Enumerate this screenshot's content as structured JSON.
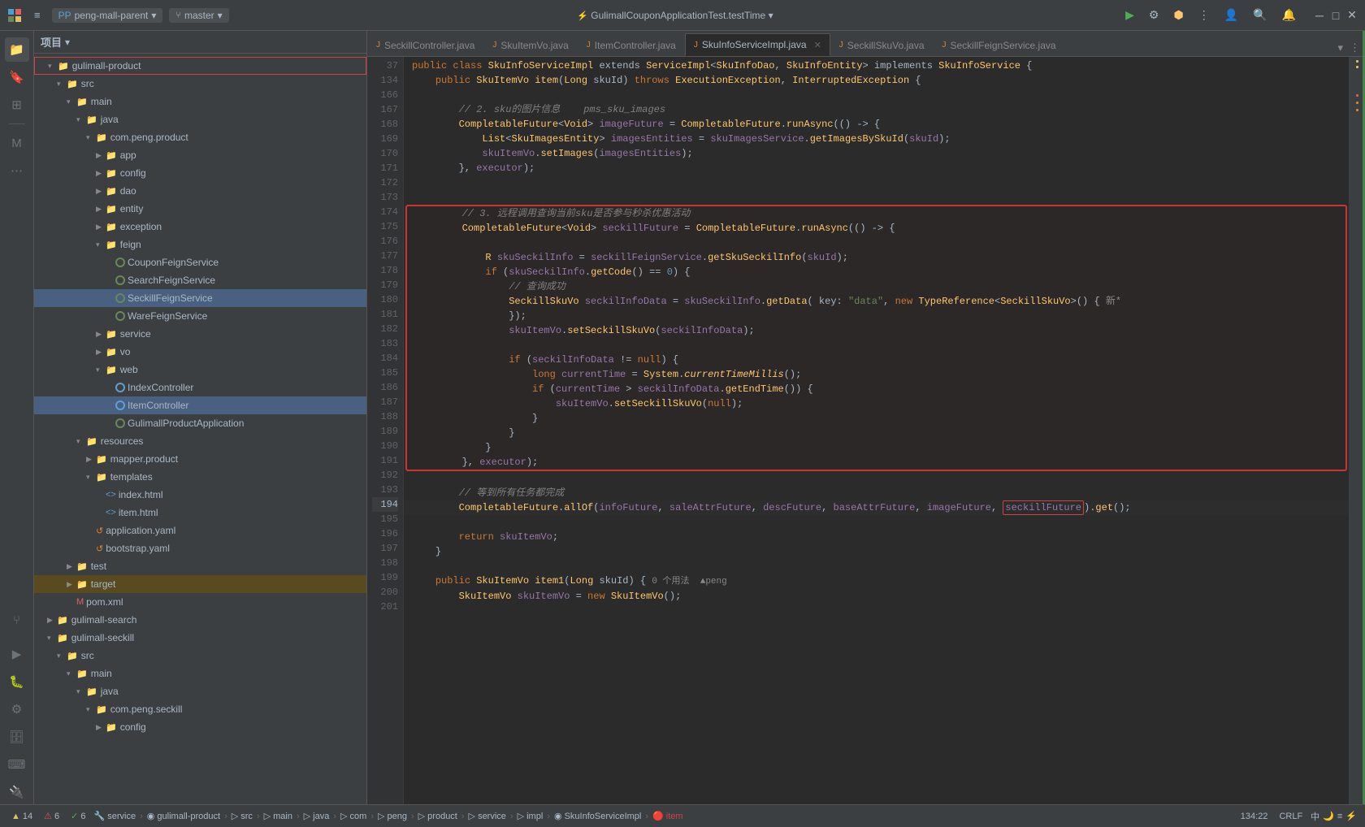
{
  "titlebar": {
    "logo": "◆",
    "menu_icon": "≡",
    "project_label": "peng-mall-parent",
    "branch_label": "master",
    "center_title": "GulimallCouponApplicationTest.testTime",
    "run_btn": "▶",
    "build_btn": "⚙",
    "vcs_btn": "⎇",
    "more_btn": "⋮",
    "user_btn": "👤",
    "search_btn": "🔍",
    "notifications_btn": "🔔",
    "minimize_btn": "─",
    "maximize_btn": "□",
    "close_btn": "✕"
  },
  "tabs": [
    {
      "label": "SeckillController.java",
      "active": false,
      "icon": "J"
    },
    {
      "label": "SkuItemVo.java",
      "active": false,
      "icon": "J"
    },
    {
      "label": "ItemController.java",
      "active": false,
      "icon": "J"
    },
    {
      "label": "SkuInfoServiceImpl.java",
      "active": true,
      "icon": "J"
    },
    {
      "label": "SeckillSkuVo.java",
      "active": false,
      "icon": "J"
    },
    {
      "label": "SeckillFeignService.java",
      "active": false,
      "icon": "J"
    }
  ],
  "project_header": {
    "title": "项目",
    "chevron": "▾"
  },
  "tree": [
    {
      "label": "gulimall-product",
      "indent": 1,
      "type": "folder_open",
      "highlighted": true,
      "arrow": "▾"
    },
    {
      "label": "src",
      "indent": 2,
      "type": "folder_open",
      "arrow": "▾"
    },
    {
      "label": "main",
      "indent": 3,
      "type": "folder_open",
      "arrow": "▾"
    },
    {
      "label": "java",
      "indent": 4,
      "type": "folder_open",
      "arrow": "▾"
    },
    {
      "label": "com.peng.product",
      "indent": 5,
      "type": "folder_open",
      "arrow": "▾"
    },
    {
      "label": "app",
      "indent": 6,
      "type": "folder",
      "arrow": "▶"
    },
    {
      "label": "config",
      "indent": 6,
      "type": "folder",
      "arrow": "▶"
    },
    {
      "label": "dao",
      "indent": 6,
      "type": "folder",
      "arrow": "▶"
    },
    {
      "label": "entity",
      "indent": 6,
      "type": "folder",
      "arrow": "▶"
    },
    {
      "label": "exception",
      "indent": 6,
      "type": "folder",
      "arrow": "▶"
    },
    {
      "label": "feign",
      "indent": 6,
      "type": "folder_open",
      "arrow": "▾"
    },
    {
      "label": "CouponFeignService",
      "indent": 7,
      "type": "circle_green"
    },
    {
      "label": "SearchFeignService",
      "indent": 7,
      "type": "circle_green"
    },
    {
      "label": "SeckillFeignService",
      "indent": 7,
      "type": "circle_green",
      "selected": true
    },
    {
      "label": "WareFeignService",
      "indent": 7,
      "type": "circle_green"
    },
    {
      "label": "service",
      "indent": 6,
      "type": "folder",
      "arrow": "▶"
    },
    {
      "label": "vo",
      "indent": 6,
      "type": "folder",
      "arrow": "▶"
    },
    {
      "label": "web",
      "indent": 6,
      "type": "folder_open",
      "arrow": "▾"
    },
    {
      "label": "IndexController",
      "indent": 7,
      "type": "circle_blue"
    },
    {
      "label": "ItemController",
      "indent": 7,
      "type": "circle_blue",
      "selected_file": true
    },
    {
      "label": "GulimallProductApplication",
      "indent": 7,
      "type": "circle_green"
    },
    {
      "label": "resources",
      "indent": 4,
      "type": "folder_open",
      "arrow": "▾"
    },
    {
      "label": "mapper.product",
      "indent": 5,
      "type": "folder",
      "arrow": "▶"
    },
    {
      "label": "templates",
      "indent": 5,
      "type": "folder_open",
      "arrow": "▾"
    },
    {
      "label": "index.html",
      "indent": 6,
      "type": "html_file"
    },
    {
      "label": "item.html",
      "indent": 6,
      "type": "html_file"
    },
    {
      "label": "application.yaml",
      "indent": 5,
      "type": "yaml_file"
    },
    {
      "label": "bootstrap.yaml",
      "indent": 5,
      "type": "yaml_file"
    },
    {
      "label": "test",
      "indent": 3,
      "type": "folder",
      "arrow": "▶"
    },
    {
      "label": "target",
      "indent": 3,
      "type": "folder_target",
      "arrow": "▶"
    },
    {
      "label": "pom.xml",
      "indent": 3,
      "type": "xml_file"
    },
    {
      "label": "gulimall-search",
      "indent": 1,
      "type": "folder",
      "arrow": "▶"
    },
    {
      "label": "gulimall-seckill",
      "indent": 1,
      "type": "folder_open",
      "arrow": "▾"
    },
    {
      "label": "src",
      "indent": 2,
      "type": "folder_open",
      "arrow": "▾"
    },
    {
      "label": "main",
      "indent": 3,
      "type": "folder_open",
      "arrow": "▾"
    },
    {
      "label": "java",
      "indent": 4,
      "type": "folder_open",
      "arrow": "▾"
    },
    {
      "label": "com.peng.seckill",
      "indent": 5,
      "type": "folder_open",
      "arrow": "▾"
    },
    {
      "label": "config",
      "indent": 6,
      "type": "folder",
      "arrow": "▶"
    }
  ],
  "code_lines": [
    {
      "num": 37,
      "content": "public class SkuInfoServiceImpl extends ServiceImpl<SkuInfoDao, SkuInfoEntity> implements SkuInfoService {",
      "type": "normal"
    },
    {
      "num": 134,
      "content": "    public SkuItemVo item(Long skuId) throws ExecutionException, InterruptedException {",
      "type": "normal"
    },
    {
      "num": 166,
      "content": "",
      "type": "normal"
    },
    {
      "num": 167,
      "content": "        // 2. sku的图片信息    pms_sku_images",
      "type": "comment"
    },
    {
      "num": 168,
      "content": "        CompletableFuture<Void> imageFuture = CompletableFuture.runAsync(() -> {",
      "type": "normal"
    },
    {
      "num": 169,
      "content": "            List<SkuImagesEntity> imagesEntities = skuImagesService.getImagesBySkuId(skuId);",
      "type": "normal"
    },
    {
      "num": 170,
      "content": "            skuItemVo.setImages(imagesEntities);",
      "type": "normal"
    },
    {
      "num": 171,
      "content": "        }, executor);",
      "type": "normal"
    },
    {
      "num": 172,
      "content": "",
      "type": "normal"
    },
    {
      "num": 173,
      "content": "",
      "type": "normal"
    },
    {
      "num": 174,
      "content": "        // 3. 远程调用查询当前sku是否参与秒杀优惠活动",
      "type": "red_block_start"
    },
    {
      "num": 175,
      "content": "        CompletableFuture<Void> seckillFuture = CompletableFuture.runAsync(() -> {",
      "type": "red_block"
    },
    {
      "num": 176,
      "content": "",
      "type": "red_block"
    },
    {
      "num": 177,
      "content": "            R skuSeckilInfo = seckillFeignService.getSkuSeckilInfo(skuId);",
      "type": "red_block"
    },
    {
      "num": 178,
      "content": "            if (skuSeckilInfo.getCode() == 0) {",
      "type": "red_block"
    },
    {
      "num": 179,
      "content": "                // 查询成功",
      "type": "red_block"
    },
    {
      "num": 180,
      "content": "                SeckillSkuVo seckilInfoData = skuSeckilInfo.getData( key: \"data\", new TypeReference<SeckillSkuVo>() { 新*",
      "type": "red_block"
    },
    {
      "num": 181,
      "content": "                });",
      "type": "red_block"
    },
    {
      "num": 182,
      "content": "                skuItemVo.setSeckillSkuVo(seckilInfoData);",
      "type": "red_block"
    },
    {
      "num": 183,
      "content": "",
      "type": "red_block"
    },
    {
      "num": 184,
      "content": "                if (seckilInfoData != null) {",
      "type": "red_block"
    },
    {
      "num": 185,
      "content": "                    long currentTime = System.currentTimeMillis();",
      "type": "red_block"
    },
    {
      "num": 186,
      "content": "                    if (currentTime > seckilInfoData.getEndTime()) {",
      "type": "red_block"
    },
    {
      "num": 187,
      "content": "                        skuItemVo.setSeckillSkuVo(null);",
      "type": "red_block"
    },
    {
      "num": 188,
      "content": "                    }",
      "type": "red_block"
    },
    {
      "num": 189,
      "content": "                }",
      "type": "red_block"
    },
    {
      "num": 190,
      "content": "            }",
      "type": "red_block"
    },
    {
      "num": 191,
      "content": "        }, executor);",
      "type": "red_block_end"
    },
    {
      "num": 192,
      "content": "",
      "type": "normal"
    },
    {
      "num": 193,
      "content": "        // 等到所有任务都完成",
      "type": "comment"
    },
    {
      "num": 194,
      "content": "        CompletableFuture.allOf(infoFuture, saleAttrFuture, descFuture, baseAttrFuture, imageFuture, seckillFuture).get();",
      "type": "normal_highlight"
    },
    {
      "num": 195,
      "content": "",
      "type": "normal"
    },
    {
      "num": 196,
      "content": "        return skuItemVo;",
      "type": "normal"
    },
    {
      "num": 197,
      "content": "    }",
      "type": "normal"
    },
    {
      "num": 198,
      "content": "",
      "type": "normal"
    },
    {
      "num": 199,
      "content": "    public SkuItemVo item1(Long skuId) { 0 个用法  ▲peng",
      "type": "normal"
    },
    {
      "num": 200,
      "content": "        SkuItemVo skuItemVo = new SkuItemVo();",
      "type": "normal"
    },
    {
      "num": 201,
      "content": "",
      "type": "normal"
    }
  ],
  "statusbar": {
    "breadcrumbs": [
      "🔧 service",
      "◉ gulimall-product",
      "▷ src",
      "▷ main",
      "▷ java",
      "▷ com",
      "▷ peng",
      "▷ product",
      "▷ service",
      "▷ impl",
      "◉ SkuInfoServiceImpl",
      "▷ 🔴 item"
    ],
    "position": "134:22",
    "encoding": "CRLF",
    "warnings": "▲ 14",
    "errors": "⚠ 6",
    "extra": "✓ 6"
  }
}
